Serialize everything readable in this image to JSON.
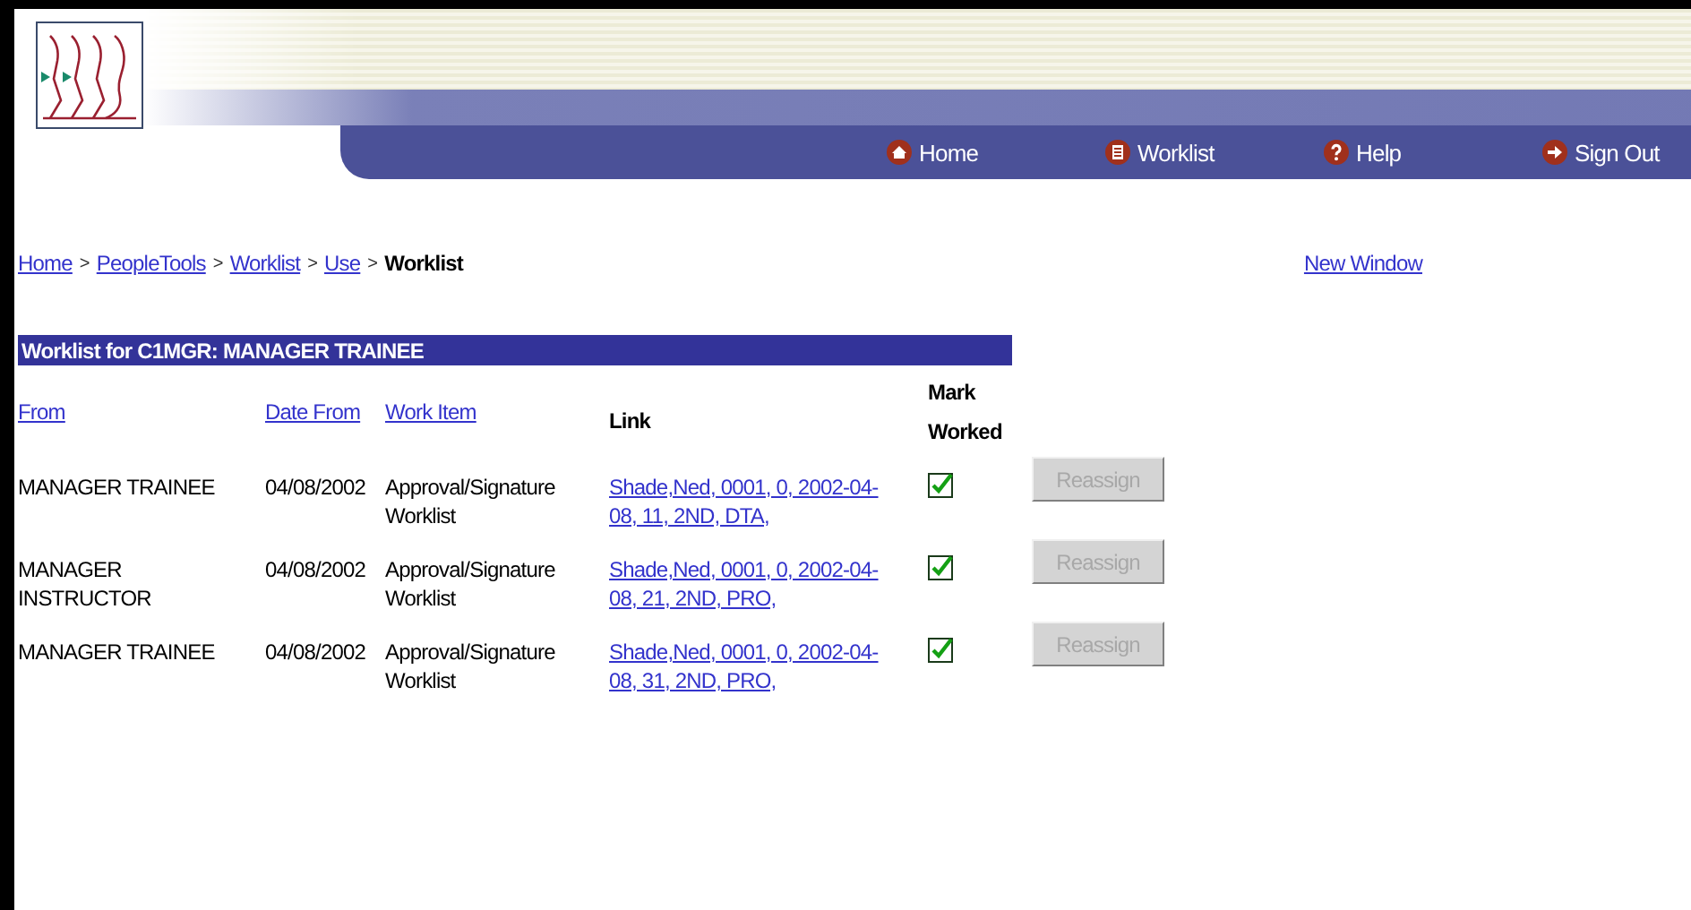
{
  "nav": [
    {
      "label": "Home",
      "kind": "home"
    },
    {
      "label": "Worklist",
      "kind": "worklist"
    },
    {
      "label": "Help",
      "kind": "help"
    },
    {
      "label": "Sign Out",
      "kind": "signout"
    }
  ],
  "breadcrumb": {
    "links": [
      "Home",
      "PeopleTools",
      "Worklist",
      "Use"
    ],
    "separator": ">",
    "current": "Worklist"
  },
  "new_window": "New Window",
  "worklist": {
    "title": "Worklist for C1MGR: MANAGER TRAINEE",
    "columns": [
      {
        "label": "From",
        "sortable": true
      },
      {
        "label": "Date From",
        "sortable": true
      },
      {
        "label": "Work Item",
        "sortable": true
      },
      {
        "label": "Link",
        "sortable": false
      },
      {
        "label": "Mark Worked",
        "sortable": false
      }
    ],
    "rows": [
      {
        "from": "MANAGER TRAINEE",
        "date_from": "04/08/2002",
        "work_item": "Approval/Signature Worklist",
        "link": "Shade,Ned, 0001, 0, 2002-04-08, 11, 2ND, DTA,",
        "checked": true,
        "button": {
          "label": "Reassign",
          "disabled": true
        }
      },
      {
        "from": "MANAGER INSTRUCTOR",
        "date_from": "04/08/2002",
        "work_item": "Approval/Signature Worklist",
        "link": "Shade,Ned, 0001, 0, 2002-04-08, 21, 2ND, PRO,",
        "checked": true,
        "button": {
          "label": "Reassign",
          "disabled": true
        }
      },
      {
        "from": "MANAGER TRAINEE",
        "date_from": "04/08/2002",
        "work_item": "Approval/Signature Worklist",
        "link": "Shade,Ned, 0001, 0, 2002-04-08, 31, 2ND, PRO,",
        "checked": true,
        "button": {
          "label": "Reassign",
          "disabled": true
        }
      }
    ]
  }
}
